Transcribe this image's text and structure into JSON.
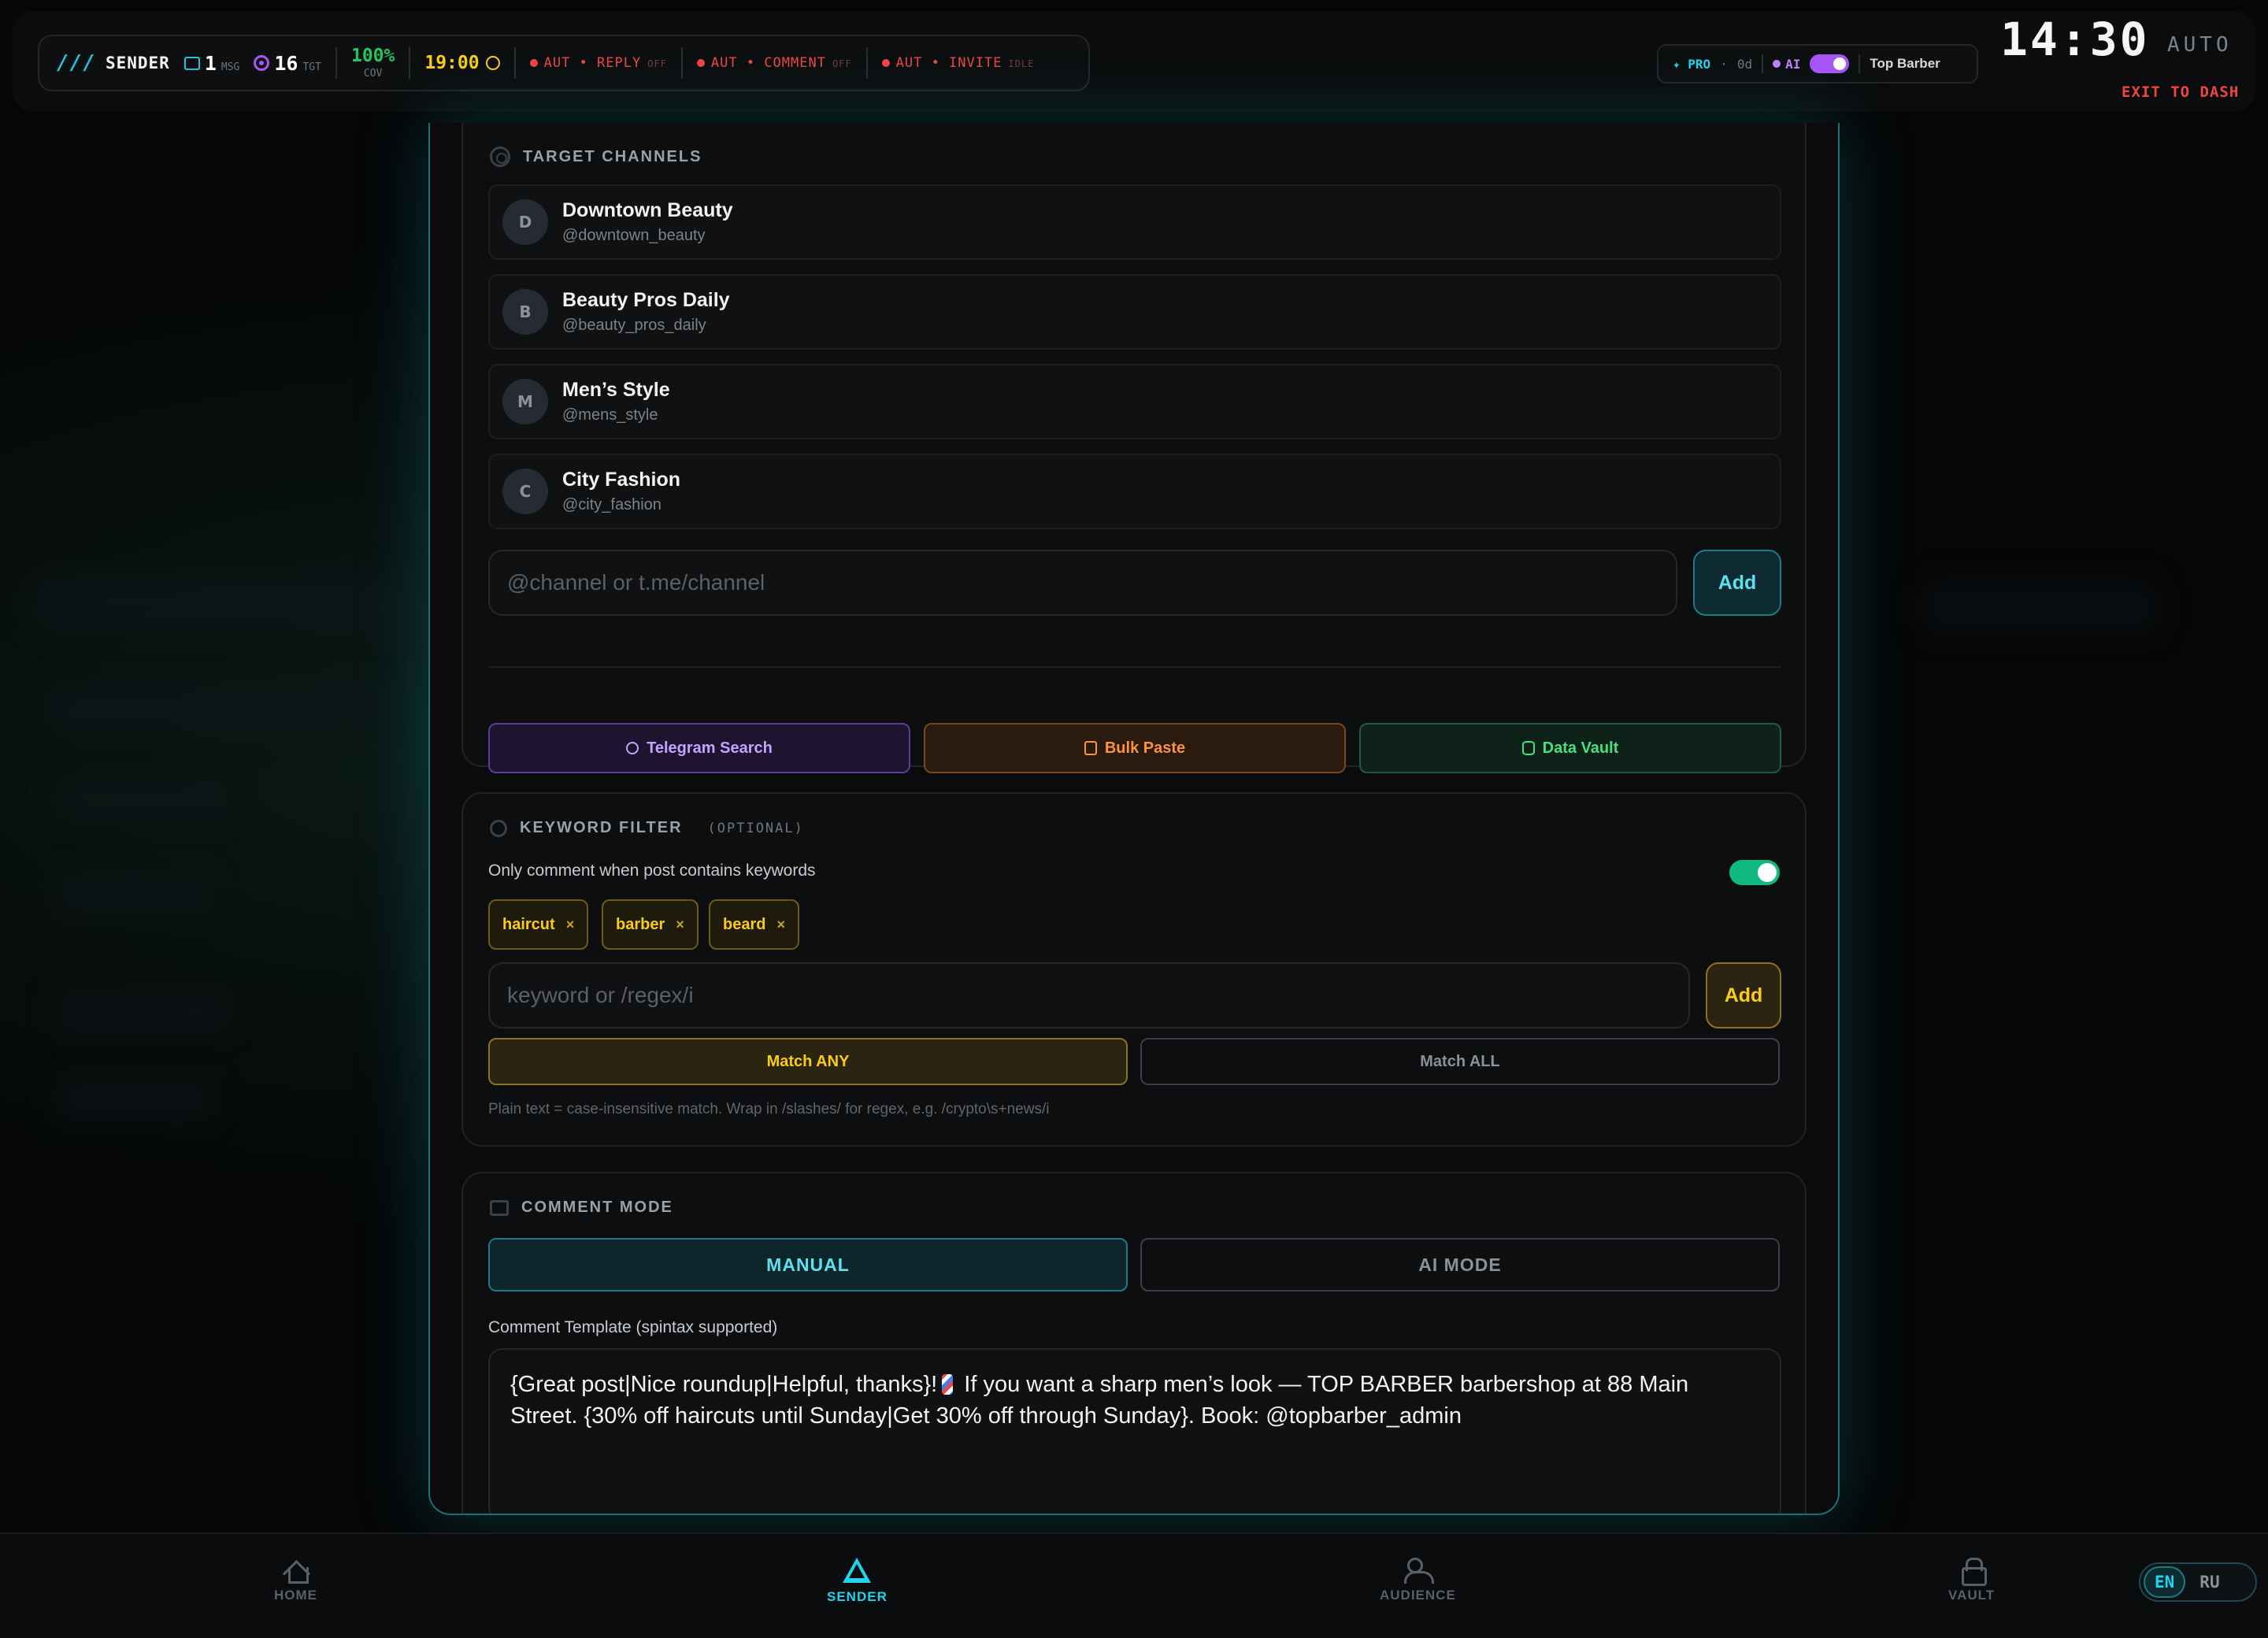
{
  "statusbar": {
    "brand_slashes": "///",
    "brand": "SENDER",
    "msg_count": "1",
    "msg_unit": "MSG",
    "tgt_count": "16",
    "tgt_unit": "TGT",
    "coverage": "100%",
    "coverage_unit": "COV",
    "time": "19:00",
    "auto_reply": {
      "label": "AUT • REPLY",
      "state": "OFF"
    },
    "auto_comment": {
      "label": "AUT • COMMENT",
      "state": "OFF"
    },
    "auto_invite": {
      "label": "AUT • INVITE",
      "state": "IDLE"
    }
  },
  "probox": {
    "plan": "✦ PRO",
    "dot": "·",
    "days": "0d",
    "ai_label": "AI",
    "account": "Top Barber"
  },
  "clock": "14:30",
  "mode_label": "AUTO",
  "exit_label": "EXIT TO DASH",
  "target_channels": {
    "title": "TARGET CHANNELS",
    "channels": [
      {
        "initial": "D",
        "name": "Downtown Beauty",
        "handle": "@downtown_beauty"
      },
      {
        "initial": "B",
        "name": "Beauty Pros Daily",
        "handle": "@beauty_pros_daily"
      },
      {
        "initial": "M",
        "name": "Men’s Style",
        "handle": "@mens_style"
      },
      {
        "initial": "C",
        "name": "City Fashion",
        "handle": "@city_fashion"
      }
    ],
    "input_placeholder": "@channel or t.me/channel",
    "add_label": "Add",
    "actions": {
      "telegram_search": "Telegram Search",
      "bulk_paste": "Bulk Paste",
      "data_vault": "Data Vault"
    }
  },
  "keyword_filter": {
    "title": "KEYWORD FILTER",
    "optional": "(OPTIONAL)",
    "description": "Only comment when post contains keywords",
    "enabled": true,
    "keywords": [
      "haircut",
      "barber",
      "beard"
    ],
    "remove_glyph": "×",
    "input_placeholder": "keyword or /regex/i",
    "add_label": "Add",
    "match_any": "Match ANY",
    "match_all": "Match ALL",
    "hint": "Plain text = case-insensitive match. Wrap in /slashes/ for regex, e.g. /crypto\\s+news/i"
  },
  "comment_mode": {
    "title": "COMMENT MODE",
    "manual": "MANUAL",
    "ai_mode": "AI MODE",
    "template_label": "Comment Template (spintax supported)",
    "template_part1": "{Great post|Nice roundup|Helpful, thanks}!",
    "template_part2": " If you want a sharp men’s look — TOP BARBER barbershop at 88 Main Street. {30% off haircuts until Sunday|Get 30% off through Sunday}. Book: @topbarber_admin"
  },
  "nav": {
    "home": "HOME",
    "sender": "SENDER",
    "audience": "AUDIENCE",
    "vault": "VAULT"
  },
  "lang": {
    "en": "EN",
    "ru": "RU"
  },
  "colors": {
    "accent_cyan": "#22d3ee",
    "accent_gold": "#facc15",
    "accent_green": "#10b981",
    "accent_purple": "#a855f7",
    "danger": "#ef4444"
  }
}
